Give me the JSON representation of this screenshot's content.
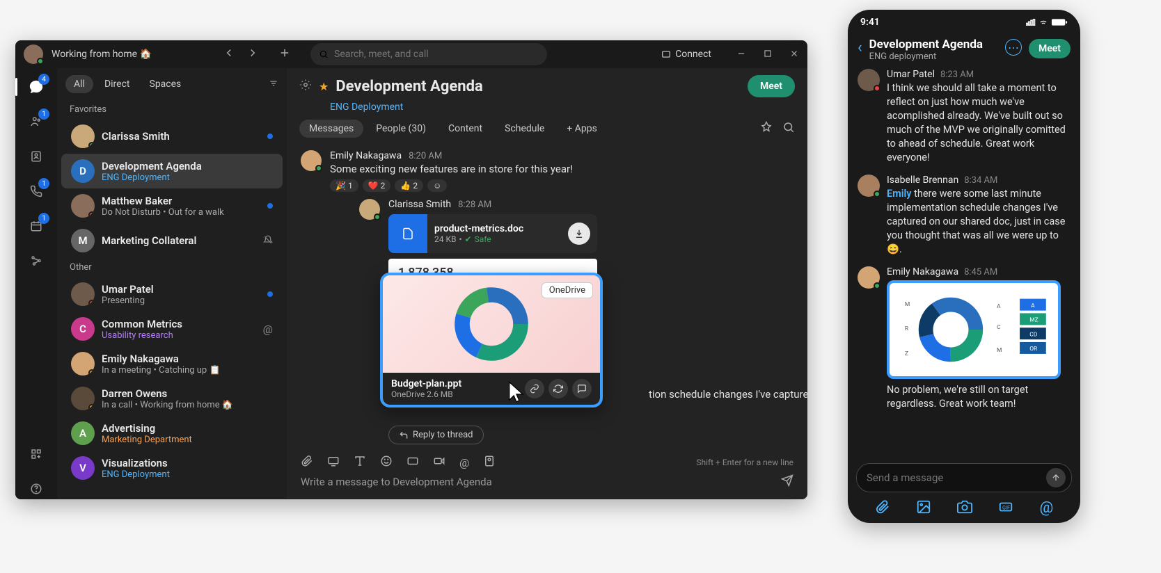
{
  "desktop": {
    "self_status": "Working from home 🏠",
    "search_placeholder": "Search, meet, and call",
    "connect_label": "Connect",
    "rail": {
      "chat_badge": "4",
      "contacts_badge": "1",
      "phone_badge": "1",
      "calendar_badge": "1"
    },
    "sidebar": {
      "tabs": [
        "All",
        "Direct",
        "Spaces"
      ],
      "section_fav": "Favorites",
      "section_other": "Other",
      "items": [
        {
          "title": "Clarissa Smith",
          "sub": "",
          "unread": true
        },
        {
          "title": "Development Agenda",
          "sub": "ENG Deployment",
          "sub_class": "link",
          "selected": true
        },
        {
          "title": "Matthew Baker",
          "sub": "Do Not Disturb  •  Out for a walk",
          "unread": true
        },
        {
          "title": "Marketing Collateral",
          "sub": ""
        },
        {
          "title": "Umar Patel",
          "sub": "Presenting",
          "unread": true
        },
        {
          "title": "Common Metrics",
          "sub": "Usability research",
          "sub_class": "purple"
        },
        {
          "title": "Emily Nakagawa",
          "sub": "In a meeting  •  Catching up 📋"
        },
        {
          "title": "Darren Owens",
          "sub": "In a call  •  Working from home 🏠"
        },
        {
          "title": "Advertising",
          "sub": "Marketing Department",
          "sub_class": "orange"
        },
        {
          "title": "Visualizations",
          "sub": "ENG Deployment",
          "sub_class": "link"
        }
      ]
    },
    "conversation": {
      "title": "Development Agenda",
      "subtitle": "ENG Deployment",
      "meet_label": "Meet",
      "tabs": [
        "Messages",
        "People (30)",
        "Content",
        "Schedule",
        "+ Apps"
      ],
      "msg1": {
        "name": "Emily Nakagawa",
        "time": "8:20 AM",
        "text": "Some exciting new features are in store for this year!"
      },
      "reactions": [
        {
          "emoji": "🎉",
          "count": "1"
        },
        {
          "emoji": "❤️",
          "count": "2"
        },
        {
          "emoji": "👍",
          "count": "2"
        },
        {
          "emoji": "☺",
          "count": ""
        }
      ],
      "reply": {
        "name": "Clarissa Smith",
        "time": "8:28 AM"
      },
      "file": {
        "name": "product-metrics.doc",
        "size": "24 KB",
        "safe_label": "Safe"
      },
      "preview_number": "1,878,358",
      "onedrive": {
        "badge": "OneDrive",
        "fname": "Budget-plan.ppt",
        "fmeta": "OneDrive 2.6 MB"
      },
      "continue_text": "tion schedule changes I've captured ere up to.",
      "reply_thread_label": "Reply to thread"
    },
    "composer": {
      "hint": "Shift + Enter for a new line",
      "placeholder": "Write a message to Development Agenda"
    }
  },
  "mobile": {
    "time": "9:41",
    "title": "Development Agenda",
    "sub": "ENG deployment",
    "meet_label": "Meet",
    "msgs": [
      {
        "name": "Umar Patel",
        "time": "8:23 AM",
        "text": "I think we should all take a moment to reflect on just how much we've acomplished already. We've built out so much of the MVP we originally comitted to ahead of schedule. Great work everyone!"
      },
      {
        "name": "Isabelle Brennan",
        "time": "8:34 AM",
        "mention": "Emily",
        "text": " there were some last minute implementation schedule changes I've captured on our shared doc, just in case you thought that was all we were up to 😄."
      },
      {
        "name": "Emily Nakagawa",
        "time": "8:45 AM",
        "text": "No problem, we're still on target regardless. Great work team!"
      }
    ],
    "input_placeholder": "Send a message"
  }
}
